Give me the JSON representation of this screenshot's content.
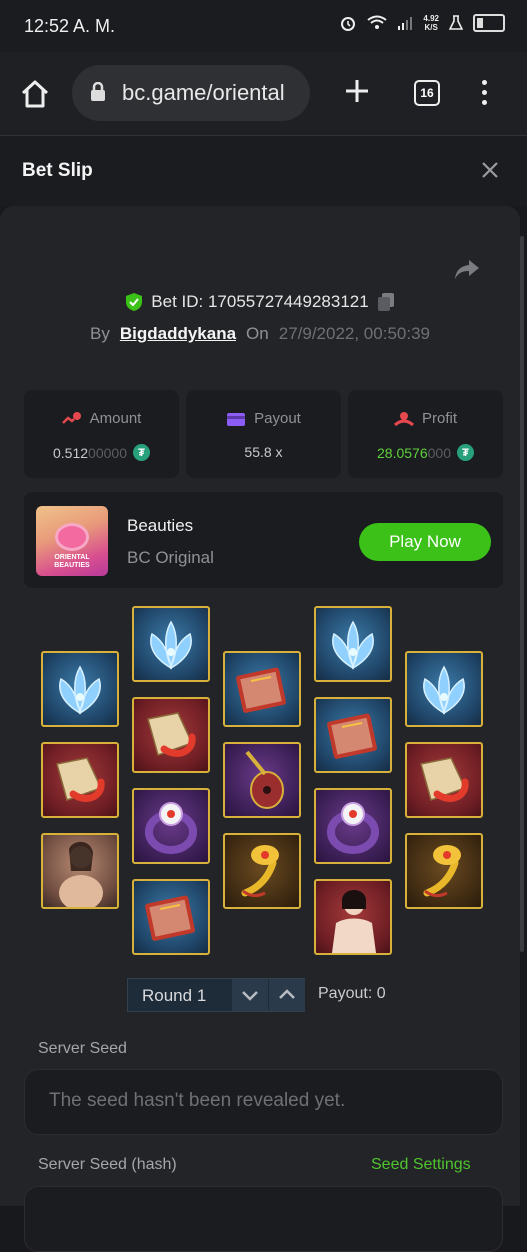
{
  "status_bar": {
    "time": "12:52 A. M.",
    "net_speed_top": "4.92",
    "net_speed_bottom": "K/S"
  },
  "browser": {
    "url": "bc.game/oriental",
    "tab_count": "16"
  },
  "bet_slip": {
    "title": "Bet Slip",
    "bet_id": "Bet ID: 17055727449283121",
    "by_label": "By",
    "username": "Bigdaddykana",
    "on_label": "On",
    "date": "27/9/2022, 00:50:39"
  },
  "stats": {
    "amount": {
      "label": "Amount",
      "value_bright": "0.512",
      "value_dim": "00000"
    },
    "payout": {
      "label": "Payout",
      "value": "55.8 x"
    },
    "profit": {
      "label": "Profit",
      "value_bright": "28.0576",
      "value_dim": "000"
    },
    "coin_symbol": "₮"
  },
  "game": {
    "name": "Beauties",
    "provider": "BC Original",
    "play_label": "Play Now",
    "thumb_text_1": "ORIENTAL",
    "thumb_text_2": "BEAUTIES"
  },
  "reels": {
    "columns": [
      [
        "lotus",
        "fan",
        "lady"
      ],
      [
        "lotus",
        "fan",
        "ring",
        "book"
      ],
      [
        "book",
        "pipa",
        "ruyi"
      ],
      [
        "lotus",
        "book",
        "ring",
        "lady2"
      ],
      [
        "lotus",
        "fan",
        "ruyi"
      ]
    ]
  },
  "round": {
    "label": "Round 1",
    "payout": "Payout: 0"
  },
  "seeds": {
    "server_seed_label": "Server Seed",
    "server_seed_placeholder": "The seed hasn't been revealed yet.",
    "server_seed_hash_label": "Server Seed (hash)",
    "seed_settings_label": "Seed Settings"
  },
  "colors": {
    "accent_green": "#3bc117",
    "tile_border": "#d7b13a"
  }
}
